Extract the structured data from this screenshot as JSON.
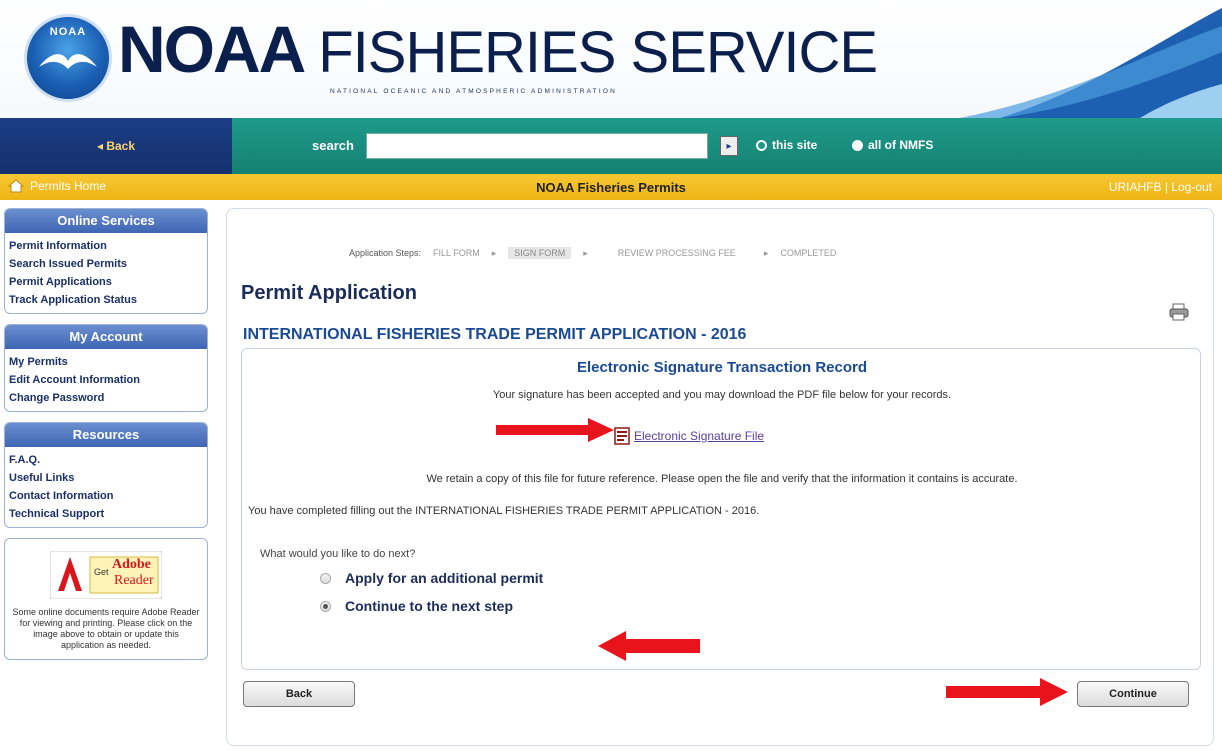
{
  "header": {
    "logo_text": "NOAA",
    "brand_main": "NOAA",
    "brand_light": "FISHERIES SERVICE",
    "brand_sub": "NATIONAL OCEANIC AND ATMOSPHERIC ADMINISTRATION"
  },
  "nav": {
    "back_label": "◂ Back",
    "search_label": "search",
    "search_value": "",
    "go_label": "▸",
    "options": [
      "this site",
      "all of NMFS"
    ],
    "selected_option": "all of NMFS"
  },
  "subnav": {
    "home_label": "Permits Home",
    "center_title": "NOAA Fisheries Permits",
    "account": "URIAHFB | Log-out"
  },
  "sidebar": {
    "online_services": {
      "title": "Online Services",
      "items": [
        "Permit Information",
        "Search Issued Permits",
        "Permit Applications",
        "Track Application Status"
      ]
    },
    "my_account": {
      "title": "My Account",
      "items": [
        "My Permits",
        "Edit Account Information",
        "Change Password"
      ]
    },
    "resources": {
      "title": "Resources",
      "items": [
        "F.A.Q.",
        "Useful Links",
        "Contact Information",
        "Technical Support"
      ]
    },
    "adobe": {
      "get_label": "Get",
      "reader_label_1": "Adobe",
      "reader_label_2": "Reader",
      "text": "Some online documents require Adobe Reader for viewing and printing. Please click on the image above to obtain or update this application as needed."
    }
  },
  "steps": {
    "label": "Application Steps:",
    "items": [
      "FILL FORM",
      "SIGN FORM",
      "REVIEW PROCESSING FEE",
      "COMPLETED"
    ],
    "active": "SIGN FORM"
  },
  "main": {
    "page_title": "Permit Application",
    "app_title": "INTERNATIONAL FISHERIES TRADE PERMIT APPLICATION - 2016",
    "record_title": "Electronic Signature Transaction Record",
    "record_line1": "Your signature has been accepted and you may download the PDF file below for your records.",
    "file_link": "Electronic Signature File",
    "record_line2": "We retain a copy of this file for future reference. Please open the file and verify that the information it contains is accurate.",
    "record_line3": "You have completed filling out the INTERNATIONAL FISHERIES TRADE PERMIT APPLICATION - 2016.",
    "next_question": "What would you like to do next?",
    "options": [
      {
        "label": "Apply for an additional permit",
        "checked": false
      },
      {
        "label": "Continue to the next step",
        "checked": true
      }
    ],
    "back_button": "Back",
    "continue_button": "Continue"
  },
  "colors": {
    "nav_teal": "#1f9a8a",
    "nav_blue": "#1d3e86",
    "yellow_bar": "#f7c733",
    "sidebar_head": "#3f65b3",
    "title_blue": "#1b4a94",
    "annotation_arrow": "#e8141c"
  },
  "icons": [
    "noaa-logo-icon",
    "home-icon",
    "print-icon",
    "pdf-icon",
    "red-arrow-icon"
  ]
}
